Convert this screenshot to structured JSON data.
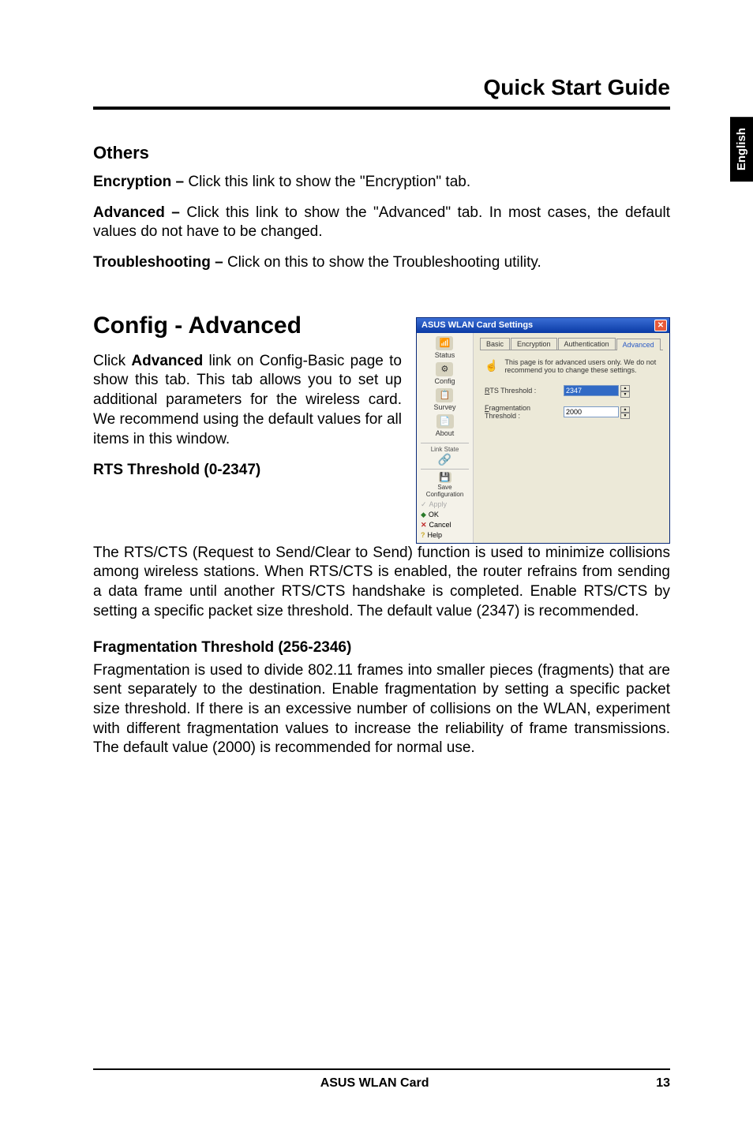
{
  "header": {
    "title": "Quick Start Guide"
  },
  "side_tab": "English",
  "sections": {
    "others_heading": "Others",
    "encryption_label": "Encryption – ",
    "encryption_text": "Click this link to show the \"Encryption\" tab.",
    "advanced_label": "Advanced – ",
    "advanced_text": "Click this link to show the \"Advanced\" tab. In most cases, the default values do not have to be changed.",
    "troubleshooting_label": "Troubleshooting – ",
    "troubleshooting_text": "Click on this to show the Troubleshooting utility.",
    "config_heading": "Config - Advanced",
    "config_intro_1": "Click ",
    "config_intro_bold": "Advanced",
    "config_intro_2": " link on Config-Basic page to show this tab. This tab allows you to set up additional parameters for the wireless card. We recommend using the default values for all items in this window.",
    "rts_heading": "RTS Threshold (0-2347)",
    "rts_text": "The RTS/CTS (Request to Send/Clear to Send) function is used to minimize collisions among wireless stations. When RTS/CTS is enabled, the router refrains from sending a data frame until another RTS/CTS handshake is completed. Enable RTS/CTS by setting a specific packet size threshold. The default value (2347) is recommended.",
    "frag_heading": "Fragmentation Threshold (256-2346)",
    "frag_text": "Fragmentation is used to divide 802.11 frames into smaller pieces (fragments) that are sent separately to the destination. Enable fragmentation by setting a specific packet size threshold. If there is an excessive number of collisions on the WLAN, experiment with different fragmentation values to increase the reliability of frame transmissions. The default value (2000) is recommended for normal use."
  },
  "dialog": {
    "title": "ASUS WLAN Card Settings",
    "sidebar": {
      "status": "Status",
      "config": "Config",
      "survey": "Survey",
      "about": "About",
      "link_state": "Link State",
      "save_config": "Save Configuration",
      "apply": "Apply",
      "ok": "OK",
      "cancel": "Cancel",
      "help": "Help"
    },
    "tabs": {
      "basic": "Basic",
      "encryption": "Encryption",
      "authentication": "Authentication",
      "advanced": "Advanced"
    },
    "info_text": "This page is for advanced users only. We do not recommend you to change these settings.",
    "rts_label": "RTS Threshold :",
    "rts_value": "2347",
    "frag_label": "Fragmentation Threshold :",
    "frag_value": "2000"
  },
  "footer": {
    "center": "ASUS WLAN Card",
    "page": "13"
  }
}
